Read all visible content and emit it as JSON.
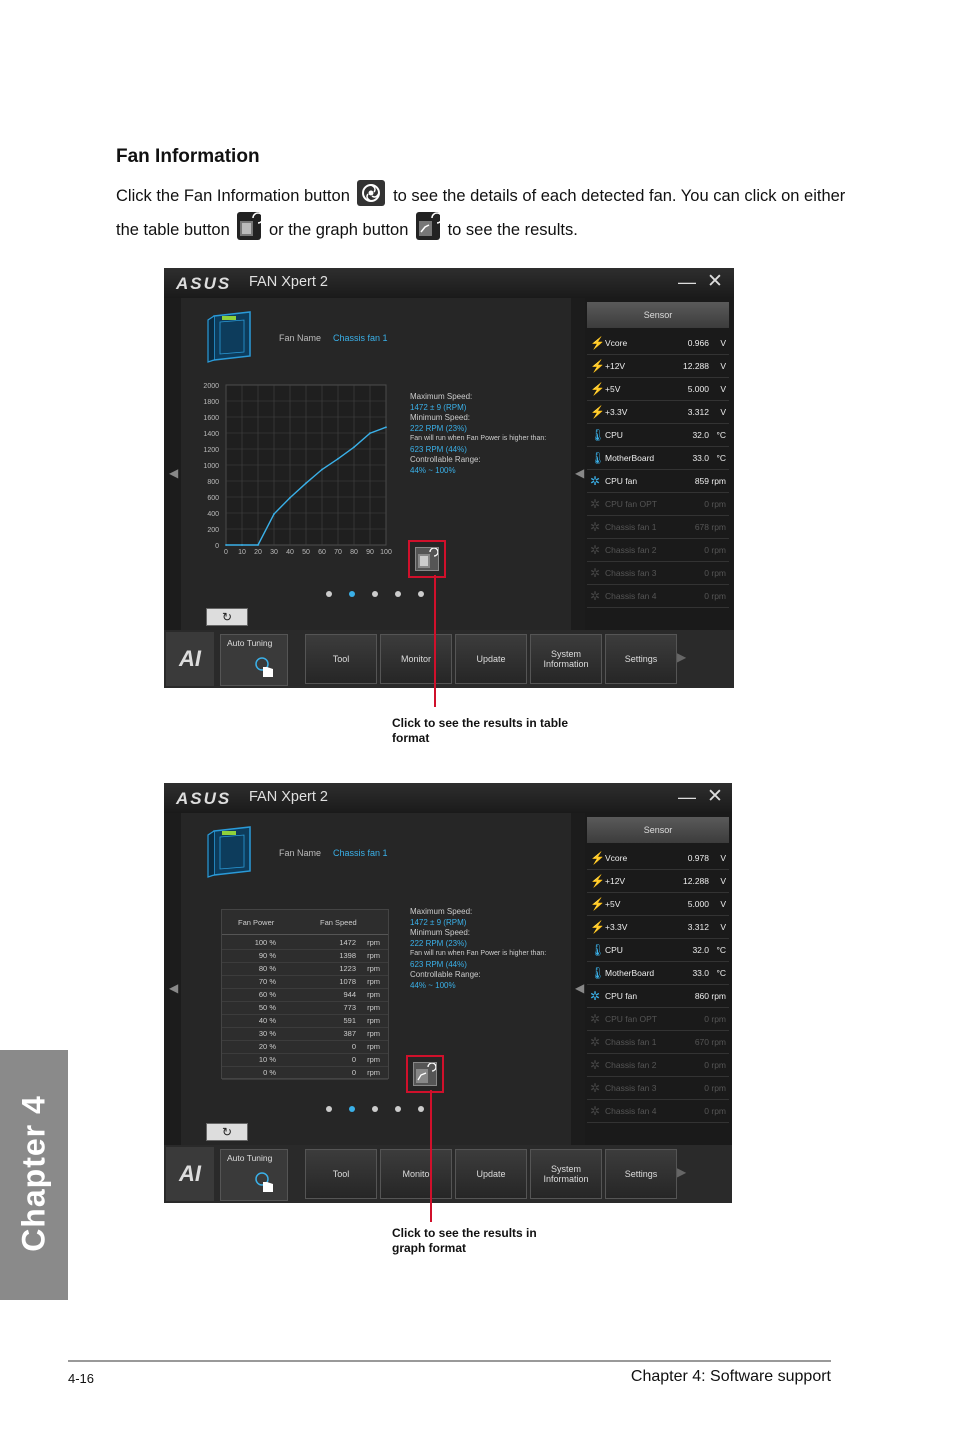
{
  "section": {
    "title": "Fan Information",
    "para_part1": "Click the Fan Information button",
    "para_part2": "to see the details of each detected fan. You can click on either the table button",
    "para_part3": "or the graph button",
    "para_part4": "to see the results."
  },
  "app": {
    "logo": "ASUS",
    "name": "FAN Xpert 2",
    "minimize": "—",
    "close": "✕",
    "fan_name_label": "Fan Name",
    "fan_name_value": "Chassis fan 1",
    "max_speed_label": "Maximum Speed:",
    "max_speed_value": "1472 ± 9 (RPM)",
    "min_speed_label": "Minimum Speed:",
    "min_speed_value": "222 RPM (23%)",
    "run_note": "Fan will run when Fan Power is higher than:",
    "run_value": "623 RPM (44%)",
    "range_label": "Controllable Range:",
    "range_value": "44% ~ 100%",
    "sensor_head": "Sensor",
    "back_icon": "↻",
    "ai_logo": "AI",
    "auto_tuning": "Auto Tuning",
    "nav": [
      "Tool",
      "Monitor",
      "Update",
      "System Information",
      "Settings"
    ],
    "nav_bottom": [
      "Tool",
      "Monito",
      "Update",
      "System Information",
      "Settings"
    ]
  },
  "sensors_top": [
    {
      "name": "Vcore",
      "value": "0.966",
      "unit": "V",
      "icon": "bolt",
      "dim": false
    },
    {
      "name": "+12V",
      "value": "12.288",
      "unit": "V",
      "icon": "bolt",
      "dim": false
    },
    {
      "name": "+5V",
      "value": "5.000",
      "unit": "V",
      "icon": "bolt",
      "dim": false
    },
    {
      "name": "+3.3V",
      "value": "3.312",
      "unit": "V",
      "icon": "bolt",
      "dim": false
    },
    {
      "name": "CPU",
      "value": "32.0",
      "unit": "°C",
      "icon": "thermo",
      "dim": false
    },
    {
      "name": "MotherBoard",
      "value": "33.0",
      "unit": "°C",
      "icon": "thermo",
      "dim": false
    },
    {
      "name": "CPU fan",
      "value": "859",
      "unit": "rpm",
      "icon": "fan",
      "dim": false
    },
    {
      "name": "CPU fan OPT",
      "value": "0",
      "unit": "rpm",
      "icon": "fan",
      "dim": true
    },
    {
      "name": "Chassis fan 1",
      "value": "678",
      "unit": "rpm",
      "icon": "fan",
      "dim": true
    },
    {
      "name": "Chassis fan 2",
      "value": "0",
      "unit": "rpm",
      "icon": "fan",
      "dim": true
    },
    {
      "name": "Chassis fan 3",
      "value": "0",
      "unit": "rpm",
      "icon": "fan",
      "dim": true
    },
    {
      "name": "Chassis fan 4",
      "value": "0",
      "unit": "rpm",
      "icon": "fan",
      "dim": true
    }
  ],
  "sensors_bottom": [
    {
      "name": "Vcore",
      "value": "0.978",
      "unit": "V",
      "icon": "bolt",
      "dim": false
    },
    {
      "name": "+12V",
      "value": "12.288",
      "unit": "V",
      "icon": "bolt",
      "dim": false
    },
    {
      "name": "+5V",
      "value": "5.000",
      "unit": "V",
      "icon": "bolt",
      "dim": false
    },
    {
      "name": "+3.3V",
      "value": "3.312",
      "unit": "V",
      "icon": "bolt",
      "dim": false
    },
    {
      "name": "CPU",
      "value": "32.0",
      "unit": "°C",
      "icon": "thermo",
      "dim": false
    },
    {
      "name": "MotherBoard",
      "value": "33.0",
      "unit": "°C",
      "icon": "thermo",
      "dim": false
    },
    {
      "name": "CPU fan",
      "value": "860",
      "unit": "rpm",
      "icon": "fan",
      "dim": false
    },
    {
      "name": "CPU fan OPT",
      "value": "0",
      "unit": "rpm",
      "icon": "fan",
      "dim": true
    },
    {
      "name": "Chassis fan 1",
      "value": "670",
      "unit": "rpm",
      "icon": "fan",
      "dim": true
    },
    {
      "name": "Chassis fan 2",
      "value": "0",
      "unit": "rpm",
      "icon": "fan",
      "dim": true
    },
    {
      "name": "Chassis fan 3",
      "value": "0",
      "unit": "rpm",
      "icon": "fan",
      "dim": true
    },
    {
      "name": "Chassis fan 4",
      "value": "0",
      "unit": "rpm",
      "icon": "fan",
      "dim": true
    }
  ],
  "fan_table": {
    "col1": "Fan Power",
    "col2": "Fan Speed",
    "rows": [
      [
        "100 %",
        "1472",
        "rpm"
      ],
      [
        "90 %",
        "1398",
        "rpm"
      ],
      [
        "80 %",
        "1223",
        "rpm"
      ],
      [
        "70 %",
        "1078",
        "rpm"
      ],
      [
        "60 %",
        "944",
        "rpm"
      ],
      [
        "50 %",
        "773",
        "rpm"
      ],
      [
        "40 %",
        "591",
        "rpm"
      ],
      [
        "30 %",
        "387",
        "rpm"
      ],
      [
        "20 %",
        "0",
        "rpm"
      ],
      [
        "10 %",
        "0",
        "rpm"
      ],
      [
        "0 %",
        "0",
        "rpm"
      ]
    ]
  },
  "chart_data": {
    "type": "line",
    "title": "",
    "xlabel": "",
    "ylabel": "",
    "x": [
      0,
      10,
      20,
      30,
      40,
      50,
      60,
      70,
      80,
      90,
      100
    ],
    "xticks": [
      "0",
      "10",
      "20",
      "30",
      "40",
      "50",
      "60",
      "70",
      "80",
      "90",
      "100"
    ],
    "yticks": [
      "2000",
      "1800",
      "1600",
      "1400",
      "1200",
      "1000",
      "800",
      "600",
      "400",
      "200",
      "0"
    ],
    "xlim": [
      0,
      100
    ],
    "ylim": [
      0,
      2000
    ],
    "grid": true,
    "series": [
      {
        "values": [
          0,
          0,
          0,
          387,
          591,
          773,
          944,
          1078,
          1223,
          1398,
          1472
        ]
      }
    ],
    "line_color": "#3ab0e8"
  },
  "callouts": {
    "table": "Click to see the results in table format",
    "graph": "Click to see the results in graph format"
  },
  "sidebar": {
    "chapter": "Chapter 4"
  },
  "footer": {
    "page": "4-16",
    "chapter": "Chapter 4: Software support"
  }
}
